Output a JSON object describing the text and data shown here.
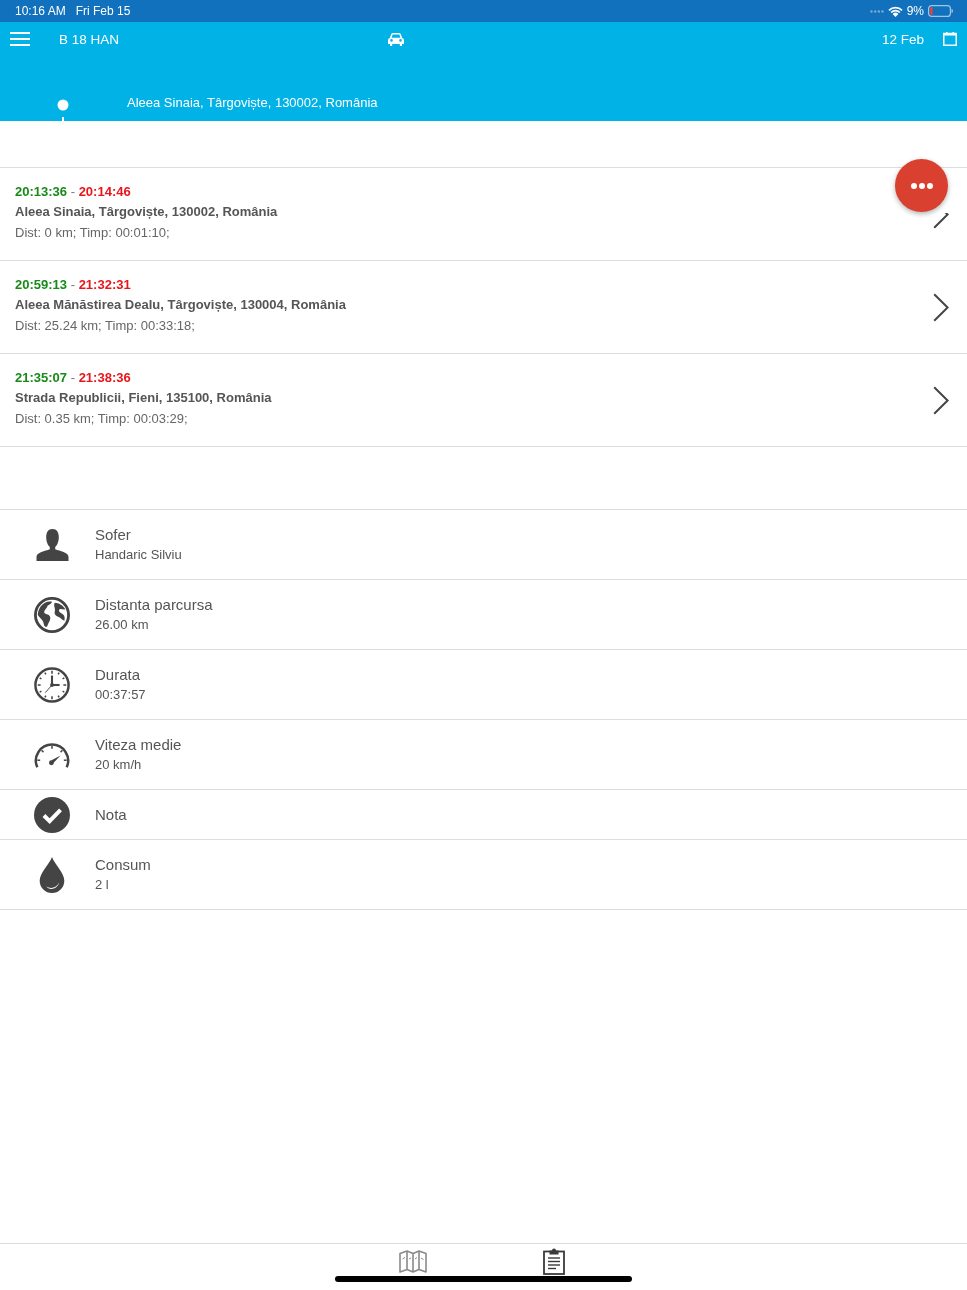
{
  "status_bar": {
    "time": "10:16 AM",
    "date": "Fri Feb 15",
    "battery": "9%"
  },
  "header": {
    "title": "B 18 HAN",
    "date": "12 Feb",
    "location": "Aleea Sinaia, Târgoviște, 130002, România"
  },
  "trips": [
    {
      "start": "20:13:36",
      "separator": "-",
      "end": "20:14:46",
      "address": "Aleea Sinaia, Târgoviște, 130002, România",
      "summary": "Dist: 0 km; Timp: 00:01:10;"
    },
    {
      "start": "20:59:13",
      "separator": "-",
      "end": "21:32:31",
      "address": "Aleea Mănăstirea Dealu, Târgoviște, 130004, România",
      "summary": "Dist: 25.24 km; Timp: 00:33:18;"
    },
    {
      "start": "21:35:07",
      "separator": "-",
      "end": "21:38:36",
      "address": "Strada Republicii, Fieni, 135100, România",
      "summary": "Dist: 0.35 km; Timp: 00:03:29;"
    }
  ],
  "info": [
    {
      "kind": "driver",
      "label": "Sofer",
      "value": "Handaric Silviu"
    },
    {
      "kind": "distance",
      "label": "Distanta parcursa",
      "value": "26.00 km"
    },
    {
      "kind": "duration",
      "label": "Durata",
      "value": "00:37:57"
    },
    {
      "kind": "speed",
      "label": "Viteza medie",
      "value": "20 km/h"
    },
    {
      "kind": "note",
      "label": "Nota"
    },
    {
      "kind": "fuel",
      "label": "Consum",
      "value": "2 l"
    }
  ],
  "tab_bar": {
    "tabs": [
      {
        "kind": "map",
        "selected": false
      },
      {
        "kind": "details",
        "selected": true
      }
    ]
  }
}
